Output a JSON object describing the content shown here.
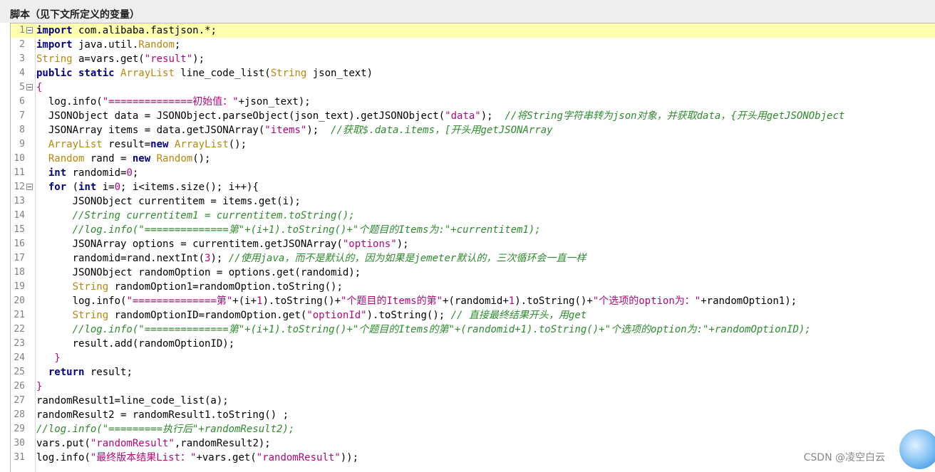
{
  "panel": {
    "title": "脚本（见下文所定义的变量）"
  },
  "editor": {
    "lines": [
      {
        "n": "1",
        "fold": true,
        "current": true,
        "tokens": [
          [
            "kw",
            "import"
          ],
          [
            "",
            "  com.alibaba.fastjson.*;"
          ]
        ]
      },
      {
        "n": "2",
        "tokens": [
          [
            "kw",
            "import"
          ],
          [
            "",
            "  java.util."
          ],
          [
            "ty",
            "Random"
          ],
          [
            "",
            ";"
          ]
        ]
      },
      {
        "n": "3",
        "tokens": [
          [
            "ty",
            "String"
          ],
          [
            "",
            "  a=vars.get("
          ],
          [
            "st",
            "\"result\""
          ],
          [
            "",
            ");"
          ]
        ]
      },
      {
        "n": "4",
        "tokens": [
          [
            "kw",
            "public static"
          ],
          [
            "",
            "  "
          ],
          [
            "ty",
            "ArrayList"
          ],
          [
            "",
            "  line_code_list("
          ],
          [
            "ty",
            "String"
          ],
          [
            "",
            "  json_text)"
          ]
        ]
      },
      {
        "n": "5",
        "fold": true,
        "tokens": [
          [
            "op",
            "{"
          ]
        ]
      },
      {
        "n": "6",
        "tokens": [
          [
            "",
            "    log.info("
          ],
          [
            "st",
            "\"==============初始值：\""
          ],
          [
            "",
            "+json_text);"
          ]
        ]
      },
      {
        "n": "7",
        "tokens": [
          [
            "",
            "    JSONObject data = JSONObject.parseObject(json_text).getJSONObject("
          ],
          [
            "st",
            "\"data\""
          ],
          [
            "",
            ");    "
          ],
          [
            "cm",
            "//将String字符串转为json对象，并获取data，{开头用getJSONObject"
          ]
        ]
      },
      {
        "n": "8",
        "tokens": [
          [
            "",
            "    JSONArray items = data.getJSONArray("
          ],
          [
            "st",
            "\"items\""
          ],
          [
            "",
            ");    "
          ],
          [
            "cm",
            "//获取$.data.items，[开头用getJSONArray"
          ]
        ]
      },
      {
        "n": "9",
        "tokens": [
          [
            "",
            "    "
          ],
          [
            "ty",
            "ArrayList"
          ],
          [
            "",
            "  result="
          ],
          [
            "kw",
            "new"
          ],
          [
            "",
            "  "
          ],
          [
            "ty",
            "ArrayList"
          ],
          [
            "",
            "();"
          ]
        ]
      },
      {
        "n": "10",
        "tokens": [
          [
            "",
            "    "
          ],
          [
            "ty",
            "Random"
          ],
          [
            "",
            "  rand = "
          ],
          [
            "kw",
            "new"
          ],
          [
            "",
            "  "
          ],
          [
            "ty",
            "Random"
          ],
          [
            "",
            "();"
          ]
        ]
      },
      {
        "n": "11",
        "tokens": [
          [
            "",
            "    "
          ],
          [
            "kw",
            "int"
          ],
          [
            "",
            "  randomid="
          ],
          [
            "nm",
            "0"
          ],
          [
            "",
            ";"
          ]
        ]
      },
      {
        "n": "12",
        "fold": true,
        "tokens": [
          [
            "",
            "    "
          ],
          [
            "kw",
            "for"
          ],
          [
            "",
            "  ("
          ],
          [
            "kw",
            "int"
          ],
          [
            "",
            "  i="
          ],
          [
            "nm",
            "0"
          ],
          [
            "",
            "; i<items.size(); i++){"
          ]
        ]
      },
      {
        "n": "13",
        "tokens": [
          [
            "",
            "            JSONObject currentitem = items.get(i);"
          ]
        ]
      },
      {
        "n": "14",
        "tokens": [
          [
            "",
            "            "
          ],
          [
            "cm",
            "//String currentitem1 = currentitem.toString();"
          ]
        ]
      },
      {
        "n": "15",
        "tokens": [
          [
            "",
            "            "
          ],
          [
            "cm",
            "//log.info(\"==============第\"+(i+1).toString()+\"个题目的Items为:\"+currentitem1);"
          ]
        ]
      },
      {
        "n": "16",
        "tokens": [
          [
            "",
            "            JSONArray options = currentitem.getJSONArray("
          ],
          [
            "st",
            "\"options\""
          ],
          [
            "",
            ");"
          ]
        ]
      },
      {
        "n": "17",
        "tokens": [
          [
            "",
            "            randomid=rand.nextInt("
          ],
          [
            "nm",
            "3"
          ],
          [
            "",
            "); "
          ],
          [
            "cm",
            "//使用java，而不是默认的，因为如果是jemeter默认的，三次循环会一直一样"
          ]
        ]
      },
      {
        "n": "18",
        "tokens": [
          [
            "",
            "            JSONObject randomOption = options.get(randomid);"
          ]
        ]
      },
      {
        "n": "19",
        "tokens": [
          [
            "",
            "            "
          ],
          [
            "ty",
            "String"
          ],
          [
            "",
            "  randomOption1=randomOption.toString();"
          ]
        ]
      },
      {
        "n": "20",
        "tokens": [
          [
            "",
            "            log.info("
          ],
          [
            "st",
            "\"==============第\""
          ],
          [
            "",
            "+(i+"
          ],
          [
            "nm",
            "1"
          ],
          [
            "",
            ").toString()+"
          ],
          [
            "st",
            "\"个题目的Items的第\""
          ],
          [
            "",
            "+(randomid+"
          ],
          [
            "nm",
            "1"
          ],
          [
            "",
            ").toString()+"
          ],
          [
            "st",
            "\"个选项的option为：\""
          ],
          [
            "",
            "+randomOption1);"
          ]
        ]
      },
      {
        "n": "21",
        "tokens": [
          [
            "",
            "            "
          ],
          [
            "ty",
            "String"
          ],
          [
            "",
            "  randomOptionID=randomOption.get("
          ],
          [
            "st",
            "\"optionId\""
          ],
          [
            "",
            ").toString();  "
          ],
          [
            "cm",
            "// 直接最终结果开头，用get"
          ]
        ]
      },
      {
        "n": "22",
        "tokens": [
          [
            "",
            "            "
          ],
          [
            "cm",
            "//log.info(\"==============第\"+(i+1).toString()+\"个题目的Items的第\"+(randomid+1).toString()+\"个选项的option为:\"+randomOptionID);"
          ]
        ]
      },
      {
        "n": "23",
        "tokens": [
          [
            "",
            "            result.add(randomOptionID);"
          ]
        ]
      },
      {
        "n": "24",
        "tokens": [
          [
            "",
            "      "
          ],
          [
            "op",
            "}"
          ]
        ]
      },
      {
        "n": "25",
        "tokens": [
          [
            "",
            "    "
          ],
          [
            "kw",
            "return"
          ],
          [
            "",
            "  result;"
          ]
        ]
      },
      {
        "n": "26",
        "tokens": [
          [
            "op",
            "}"
          ]
        ]
      },
      {
        "n": "27",
        "tokens": [
          [
            "",
            "randomResult1=line_code_list(a);"
          ]
        ]
      },
      {
        "n": "28",
        "tokens": [
          [
            "",
            "randomResult2 = randomResult1.toString() ;"
          ]
        ]
      },
      {
        "n": "29",
        "tokens": [
          [
            "cm",
            "//log.info(\"=========执行后\"+randomResult2);"
          ]
        ]
      },
      {
        "n": "30",
        "tokens": [
          [
            "",
            "vars.put("
          ],
          [
            "st",
            "\"randomResult\""
          ],
          [
            "",
            ",randomResult2);"
          ]
        ]
      },
      {
        "n": "31",
        "tokens": [
          [
            "",
            "log.info("
          ],
          [
            "st",
            "\"最终版本结果List：\""
          ],
          [
            "",
            "+vars.get("
          ],
          [
            "st",
            "\"randomResult\""
          ],
          [
            "",
            "));"
          ]
        ]
      }
    ]
  },
  "watermark": {
    "text": "CSDN @凌空白云"
  }
}
